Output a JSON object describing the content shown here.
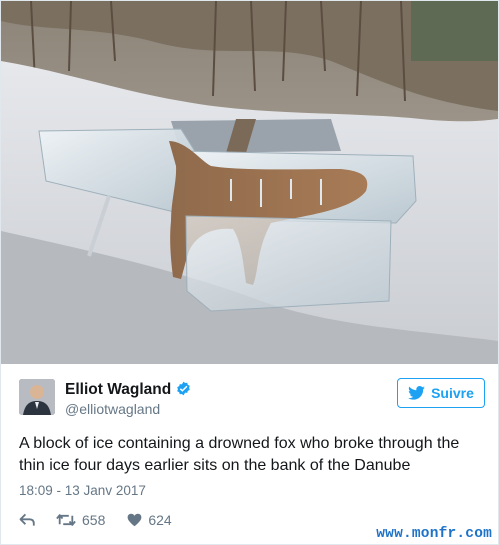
{
  "tweet": {
    "author_name": "Elliot Wagland",
    "author_handle": "@elliotwagland",
    "follow_label": "Suivre",
    "text": "A block of ice containing a drowned fox who broke through the thin ice four days earlier sits on the bank of the Danube",
    "timestamp": "18:09 - 13 Janv 2017",
    "retweet_count": "658",
    "like_count": "624"
  },
  "watermark": "www.monfr.com",
  "icons": {
    "verified": "verified-badge-icon",
    "follow": "twitter-bird-icon",
    "reply": "reply-icon",
    "retweet": "retweet-icon",
    "like": "heart-icon"
  },
  "colors": {
    "accent": "#1da1f2",
    "secondary_text": "#657786",
    "primary_text": "#14171a",
    "watermark": "#1e73c8"
  }
}
